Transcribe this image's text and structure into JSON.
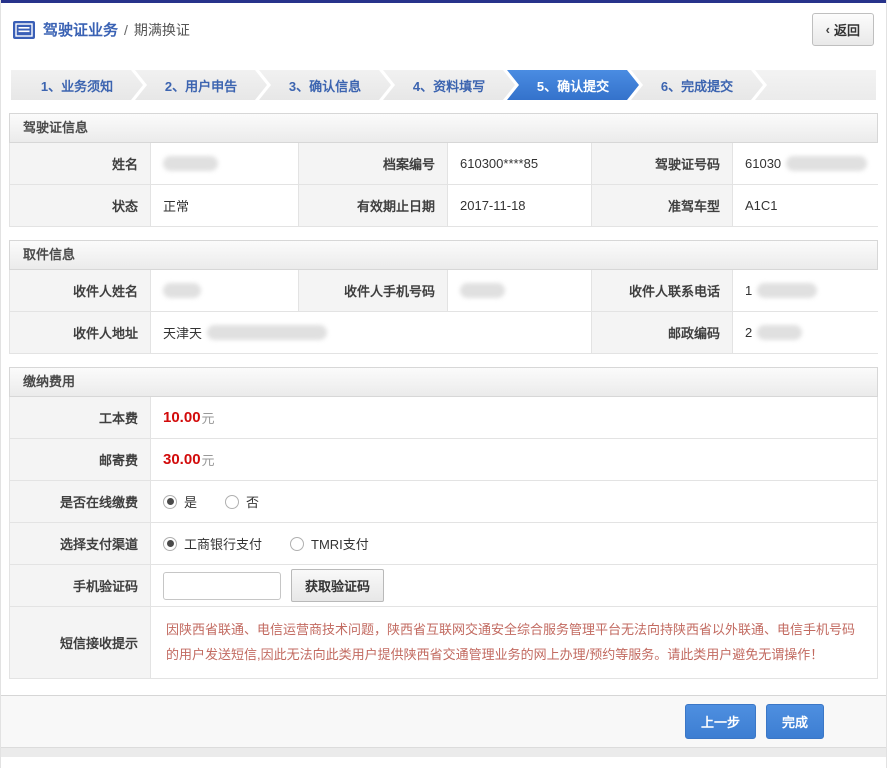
{
  "header": {
    "title": "驾驶证业务",
    "separator": "/",
    "subtitle": "期满换证",
    "back_chevron": "‹",
    "back_label": "返回"
  },
  "steps": {
    "active_index": 4,
    "items": [
      {
        "label": "1、业务须知"
      },
      {
        "label": "2、用户申告"
      },
      {
        "label": "3、确认信息"
      },
      {
        "label": "4、资料填写"
      },
      {
        "label": "5、确认提交"
      },
      {
        "label": "6、完成提交"
      }
    ]
  },
  "license_section": {
    "title": "驾驶证信息",
    "name_label": "姓名",
    "name_value": "",
    "file_no_label": "档案编号",
    "file_no_value": "610300****85",
    "license_no_label": "驾驶证号码",
    "license_no_prefix": "61030",
    "status_label": "状态",
    "status_value": "正常",
    "expiry_label": "有效期止日期",
    "expiry_value": "2017-11-18",
    "vehicle_class_label": "准驾车型",
    "vehicle_class_value": "A1C1"
  },
  "pickup_section": {
    "title": "取件信息",
    "recipient_name_label": "收件人姓名",
    "recipient_mobile_label": "收件人手机号码",
    "recipient_phone_label": "收件人联系电话",
    "recipient_phone_prefix": "1",
    "address_label": "收件人地址",
    "address_prefix": "天津天",
    "postcode_label": "邮政编码",
    "postcode_prefix": "2"
  },
  "payment_section": {
    "title": "缴纳费用",
    "production_fee_label": "工本费",
    "production_fee_value": "10.00",
    "postage_fee_label": "邮寄费",
    "postage_fee_value": "30.00",
    "fee_unit": "元",
    "online_pay_label": "是否在线缴费",
    "online_pay_options": [
      {
        "label": "是",
        "selected": true
      },
      {
        "label": "否",
        "selected": false
      }
    ],
    "channel_label": "选择支付渠道",
    "channel_options": [
      {
        "label": "工商银行支付",
        "selected": true
      },
      {
        "label": "TMRI支付",
        "selected": false
      }
    ],
    "sms_code_label": "手机验证码",
    "sms_code_value": "",
    "get_code_button": "获取验证码",
    "notice_label": "短信接收提示",
    "notice_text": "因陕西省联通、电信运营商技术问题，陕西省互联网交通安全综合服务管理平台无法向持陕西省以外联通、电信手机号码的用户发送短信,因此无法向此类用户提供陕西省交通管理业务的网上办理/预约等服务。请此类用户避免无谓操作！"
  },
  "footer": {
    "prev_label": "上一步",
    "finish_label": "完成"
  },
  "colors": {
    "top_border": "#27338b",
    "accent_blue": "#3c64b0",
    "active_step_blue": "#3d7ed2",
    "price_red": "#d20b0b",
    "notice_red": "#c26a60",
    "button_blue": "#4486d8"
  }
}
